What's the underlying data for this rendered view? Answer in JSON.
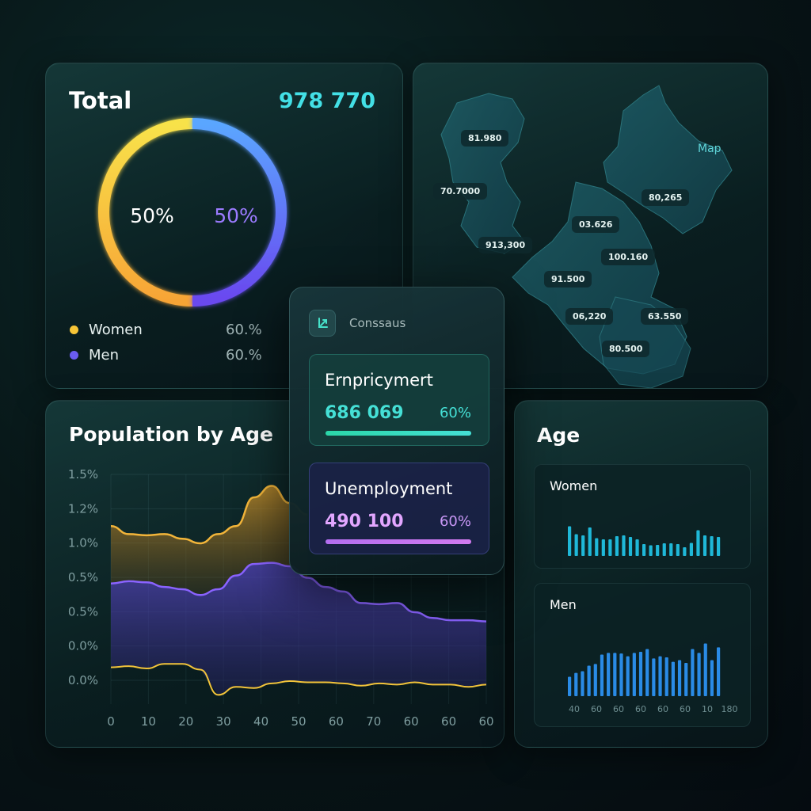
{
  "total": {
    "title": "Total",
    "value": "978 770",
    "donut": {
      "left_pct": "50%",
      "right_pct": "50%",
      "split": 0.5
    },
    "legend": [
      {
        "label": "Women",
        "value": "60.%",
        "color": "#f7c537"
      },
      {
        "label": "Men",
        "value": "60.%",
        "color": "#6a5cf0"
      }
    ]
  },
  "map": {
    "label": "Map",
    "tags": [
      "81.980",
      "70.7000",
      "913,300",
      "03.626",
      "80,265",
      "100.160",
      "91.500",
      "06,220",
      "63.550",
      "80.500"
    ]
  },
  "census": {
    "icon": "chart-arrow-icon",
    "label": "Conssaus",
    "employment": {
      "title": "Ernpricymert",
      "value": "686 069",
      "pct": "60%",
      "color": "#45e0d6",
      "fill": 1.0
    },
    "unemployment": {
      "title": "Unemployment",
      "value": "490 100",
      "pct": "60%",
      "color": "#d27af0",
      "fill": 1.0
    }
  },
  "population_by_age": {
    "title": "Population by Age",
    "chart_data": {
      "type": "area",
      "y_tick_labels": [
        "1.5%",
        "1.2%",
        "1.0%",
        "0.5%",
        "0.5%",
        "0.0%",
        "0.0%"
      ],
      "x_tick_labels": [
        "0",
        "10",
        "20",
        "30",
        "40",
        "50",
        "60",
        "70",
        "60",
        "60",
        "60"
      ],
      "x": [
        0,
        5,
        10,
        15,
        20,
        25,
        30,
        35,
        40,
        45,
        50,
        55,
        60,
        65,
        70,
        75,
        80,
        85,
        90,
        95,
        100,
        105
      ],
      "grid": true,
      "series": [
        {
          "color": "#f2b53a",
          "values": [
            1.05,
            0.98,
            0.97,
            0.98,
            0.94,
            0.9,
            0.98,
            1.05,
            1.3,
            1.4,
            1.25,
            1.15,
            null,
            null,
            null,
            null,
            null,
            null,
            null,
            null,
            null,
            null
          ]
        },
        {
          "color": "#8a63ff",
          "values": [
            0.55,
            0.57,
            0.56,
            0.52,
            0.5,
            0.45,
            0.5,
            0.62,
            0.72,
            0.73,
            0.7,
            0.6,
            0.52,
            0.48,
            0.38,
            0.37,
            0.38,
            0.3,
            0.25,
            0.23,
            0.23,
            0.22
          ]
        },
        {
          "color": "#f2c43a",
          "values": [
            -0.18,
            -0.17,
            -0.19,
            -0.15,
            -0.15,
            -0.2,
            -0.42,
            -0.35,
            -0.36,
            -0.32,
            -0.3,
            -0.31,
            -0.31,
            -0.32,
            -0.34,
            -0.32,
            -0.33,
            -0.31,
            -0.33,
            -0.33,
            -0.35,
            -0.33
          ]
        }
      ],
      "ylim": [
        -0.5,
        1.5
      ]
    }
  },
  "age": {
    "title": "Age",
    "women": {
      "label": "Women",
      "chart_data": {
        "type": "bar",
        "color": "#1fb8d8",
        "values": [
          0.75,
          0.55,
          0.52,
          0.72,
          0.45,
          0.42,
          0.42,
          0.5,
          0.52,
          0.48,
          0.42,
          0.3,
          0.27,
          0.28,
          0.32,
          0.32,
          0.3,
          0.22,
          0.33,
          0.65,
          0.52,
          0.5,
          0.48
        ]
      }
    },
    "men": {
      "label": "Men",
      "x_tick_labels": [
        "40",
        "60",
        "60",
        "60",
        "60",
        "60",
        "10",
        "180"
      ],
      "chart_data": {
        "type": "bar",
        "color": "#2a8be6",
        "values": [
          0.35,
          0.42,
          0.45,
          0.55,
          0.58,
          0.75,
          0.78,
          0.78,
          0.77,
          0.72,
          0.78,
          0.8,
          0.85,
          0.68,
          0.72,
          0.7,
          0.62,
          0.65,
          0.6,
          0.85,
          0.78,
          0.95,
          0.65,
          0.88
        ]
      }
    }
  }
}
